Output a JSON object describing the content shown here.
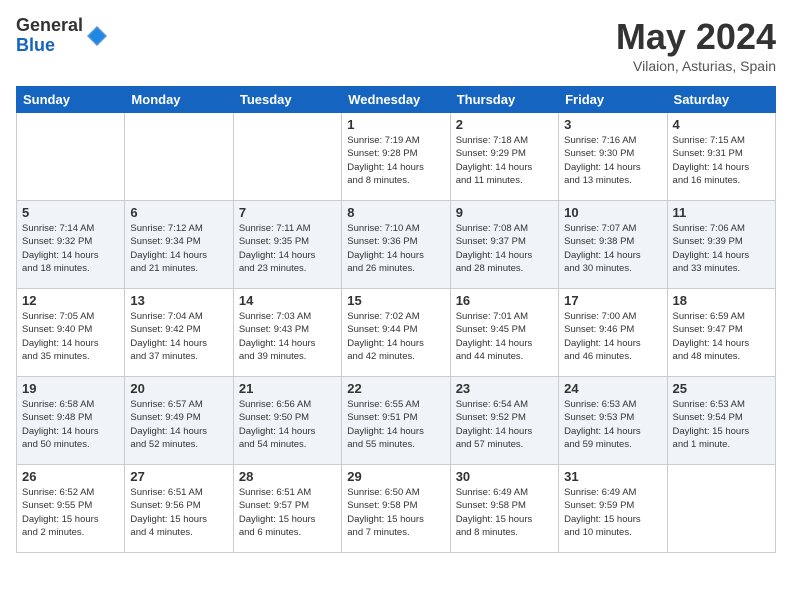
{
  "header": {
    "logo_general": "General",
    "logo_blue": "Blue",
    "month_title": "May 2024",
    "subtitle": "Vilaion, Asturias, Spain"
  },
  "weekdays": [
    "Sunday",
    "Monday",
    "Tuesday",
    "Wednesday",
    "Thursday",
    "Friday",
    "Saturday"
  ],
  "weeks": [
    [
      {
        "day": "",
        "info": ""
      },
      {
        "day": "",
        "info": ""
      },
      {
        "day": "",
        "info": ""
      },
      {
        "day": "1",
        "info": "Sunrise: 7:19 AM\nSunset: 9:28 PM\nDaylight: 14 hours\nand 8 minutes."
      },
      {
        "day": "2",
        "info": "Sunrise: 7:18 AM\nSunset: 9:29 PM\nDaylight: 14 hours\nand 11 minutes."
      },
      {
        "day": "3",
        "info": "Sunrise: 7:16 AM\nSunset: 9:30 PM\nDaylight: 14 hours\nand 13 minutes."
      },
      {
        "day": "4",
        "info": "Sunrise: 7:15 AM\nSunset: 9:31 PM\nDaylight: 14 hours\nand 16 minutes."
      }
    ],
    [
      {
        "day": "5",
        "info": "Sunrise: 7:14 AM\nSunset: 9:32 PM\nDaylight: 14 hours\nand 18 minutes."
      },
      {
        "day": "6",
        "info": "Sunrise: 7:12 AM\nSunset: 9:34 PM\nDaylight: 14 hours\nand 21 minutes."
      },
      {
        "day": "7",
        "info": "Sunrise: 7:11 AM\nSunset: 9:35 PM\nDaylight: 14 hours\nand 23 minutes."
      },
      {
        "day": "8",
        "info": "Sunrise: 7:10 AM\nSunset: 9:36 PM\nDaylight: 14 hours\nand 26 minutes."
      },
      {
        "day": "9",
        "info": "Sunrise: 7:08 AM\nSunset: 9:37 PM\nDaylight: 14 hours\nand 28 minutes."
      },
      {
        "day": "10",
        "info": "Sunrise: 7:07 AM\nSunset: 9:38 PM\nDaylight: 14 hours\nand 30 minutes."
      },
      {
        "day": "11",
        "info": "Sunrise: 7:06 AM\nSunset: 9:39 PM\nDaylight: 14 hours\nand 33 minutes."
      }
    ],
    [
      {
        "day": "12",
        "info": "Sunrise: 7:05 AM\nSunset: 9:40 PM\nDaylight: 14 hours\nand 35 minutes."
      },
      {
        "day": "13",
        "info": "Sunrise: 7:04 AM\nSunset: 9:42 PM\nDaylight: 14 hours\nand 37 minutes."
      },
      {
        "day": "14",
        "info": "Sunrise: 7:03 AM\nSunset: 9:43 PM\nDaylight: 14 hours\nand 39 minutes."
      },
      {
        "day": "15",
        "info": "Sunrise: 7:02 AM\nSunset: 9:44 PM\nDaylight: 14 hours\nand 42 minutes."
      },
      {
        "day": "16",
        "info": "Sunrise: 7:01 AM\nSunset: 9:45 PM\nDaylight: 14 hours\nand 44 minutes."
      },
      {
        "day": "17",
        "info": "Sunrise: 7:00 AM\nSunset: 9:46 PM\nDaylight: 14 hours\nand 46 minutes."
      },
      {
        "day": "18",
        "info": "Sunrise: 6:59 AM\nSunset: 9:47 PM\nDaylight: 14 hours\nand 48 minutes."
      }
    ],
    [
      {
        "day": "19",
        "info": "Sunrise: 6:58 AM\nSunset: 9:48 PM\nDaylight: 14 hours\nand 50 minutes."
      },
      {
        "day": "20",
        "info": "Sunrise: 6:57 AM\nSunset: 9:49 PM\nDaylight: 14 hours\nand 52 minutes."
      },
      {
        "day": "21",
        "info": "Sunrise: 6:56 AM\nSunset: 9:50 PM\nDaylight: 14 hours\nand 54 minutes."
      },
      {
        "day": "22",
        "info": "Sunrise: 6:55 AM\nSunset: 9:51 PM\nDaylight: 14 hours\nand 55 minutes."
      },
      {
        "day": "23",
        "info": "Sunrise: 6:54 AM\nSunset: 9:52 PM\nDaylight: 14 hours\nand 57 minutes."
      },
      {
        "day": "24",
        "info": "Sunrise: 6:53 AM\nSunset: 9:53 PM\nDaylight: 14 hours\nand 59 minutes."
      },
      {
        "day": "25",
        "info": "Sunrise: 6:53 AM\nSunset: 9:54 PM\nDaylight: 15 hours\nand 1 minute."
      }
    ],
    [
      {
        "day": "26",
        "info": "Sunrise: 6:52 AM\nSunset: 9:55 PM\nDaylight: 15 hours\nand 2 minutes."
      },
      {
        "day": "27",
        "info": "Sunrise: 6:51 AM\nSunset: 9:56 PM\nDaylight: 15 hours\nand 4 minutes."
      },
      {
        "day": "28",
        "info": "Sunrise: 6:51 AM\nSunset: 9:57 PM\nDaylight: 15 hours\nand 6 minutes."
      },
      {
        "day": "29",
        "info": "Sunrise: 6:50 AM\nSunset: 9:58 PM\nDaylight: 15 hours\nand 7 minutes."
      },
      {
        "day": "30",
        "info": "Sunrise: 6:49 AM\nSunset: 9:58 PM\nDaylight: 15 hours\nand 8 minutes."
      },
      {
        "day": "31",
        "info": "Sunrise: 6:49 AM\nSunset: 9:59 PM\nDaylight: 15 hours\nand 10 minutes."
      },
      {
        "day": "",
        "info": ""
      }
    ]
  ]
}
